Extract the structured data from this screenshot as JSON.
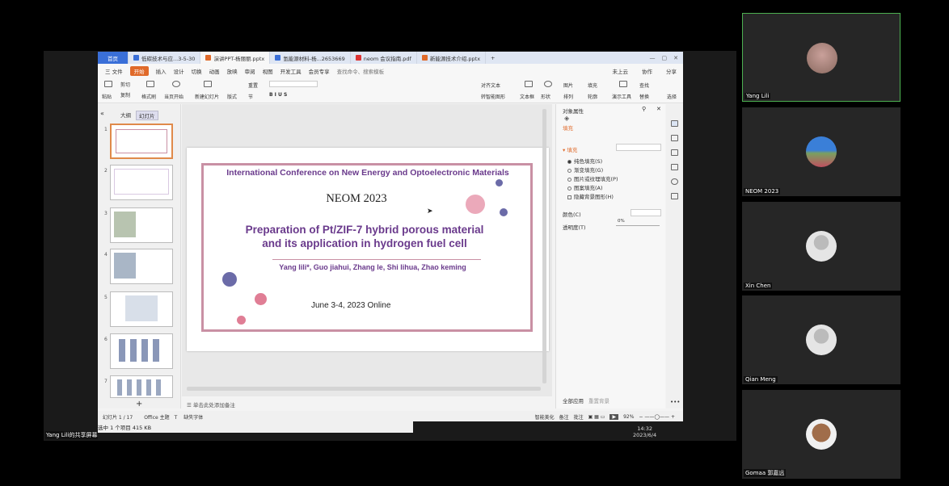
{
  "wps": {
    "home_tab": "首页",
    "tabs": [
      "低碳技术与应...3-5-30",
      "演讲PPT-杨丽丽.pptx",
      "氢能源材料-杨...2653669",
      "neom 会议指南.pdf",
      "新能源技术介绍.pptx"
    ],
    "menu": {
      "file": "三 文件",
      "start": "开始",
      "items": [
        "插入",
        "设计",
        "切换",
        "动画",
        "放映",
        "审阅",
        "视图",
        "开发工具",
        "会员专享"
      ],
      "search": "查找命令、搜索模板",
      "right": [
        "未上云",
        "协作",
        "分享"
      ]
    },
    "ribbon": [
      "粘贴",
      "剪切",
      "复制",
      "格式刷",
      "当页开始",
      "新建幻灯片",
      "版式",
      "节",
      "重置",
      "对齐文本",
      "转智能图形",
      "文本框",
      "形状",
      "图片",
      "排列",
      "填充",
      "轮廓",
      "演示工具",
      "查找",
      "替换",
      "选择"
    ],
    "panel_tabs": [
      "大纲",
      "幻灯片"
    ],
    "thumbnails": [
      "1",
      "2",
      "3",
      "4",
      "5",
      "6",
      "7"
    ],
    "slide": {
      "conference": "International Conference on New Energy and Optoelectronic Materials",
      "event": "NEOM 2023",
      "title_line1": "Preparation of Pt/ZIF-7 hybrid porous material",
      "title_line2": "and its application in hydrogen fuel cell",
      "authors": "Yang lili*, Guo jiahui, Zhang le, Shi lihua, Zhao keming",
      "date": "June 3-4, 2023 Online"
    },
    "notes_placeholder": "单击此处添加备注",
    "properties": {
      "header": "对象属性",
      "fill_tab": "填充",
      "fill_section": "填充",
      "options": [
        "纯色填充(S)",
        "渐变填充(G)",
        "图片或纹理填充(P)",
        "图案填充(A)",
        "隐藏背景图形(H)"
      ],
      "color_label": "颜色(C)",
      "transparency_label": "透明度(T)",
      "transparency_value": "0%",
      "apply_all": "全部应用",
      "reset_bg": "重置背景"
    },
    "status": {
      "slide_count": "幻灯片 1 / 17",
      "theme": "Office 主题",
      "missing_font": "缺失字体",
      "smart": "智能美化",
      "notes": "备注",
      "comments": "批注",
      "zoom": "92%"
    },
    "explorer_info": "选中 1 个项目  415 KB"
  },
  "share_label": "Yang Lili的共享屏幕",
  "clock": {
    "time": "14:32",
    "date": "2023/6/4"
  },
  "participants": [
    {
      "name": "Yang Lili",
      "active": true
    },
    {
      "name": "NEOM 2023",
      "active": false
    },
    {
      "name": "Xin Chen",
      "active": false
    },
    {
      "name": "Qian Meng",
      "active": false
    },
    {
      "name": "Gomaa 郭嘉远",
      "active": false
    }
  ],
  "colors": {
    "accent_purple": "#6a3a8c",
    "slide_border": "#c990a4",
    "active_tile": "#4caf50",
    "wps_blue": "#3a6fd8",
    "start_orange": "#e06a2a"
  }
}
